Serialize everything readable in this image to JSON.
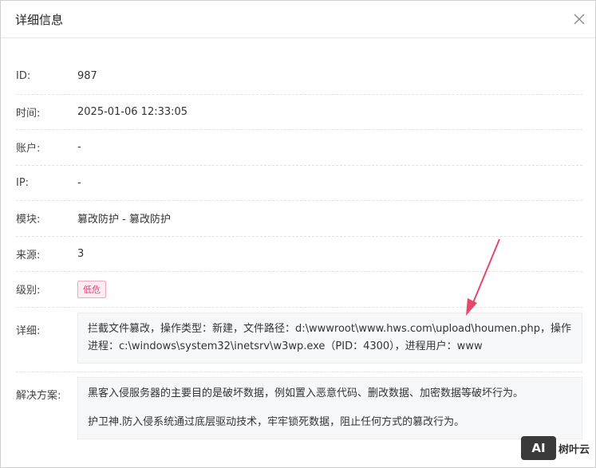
{
  "dialog": {
    "title": "详细信息"
  },
  "fields": {
    "id": {
      "label": "ID:",
      "value": "987"
    },
    "time": {
      "label": "时间:",
      "value": "2025-01-06 12:33:05"
    },
    "account": {
      "label": "账户:",
      "value": "-"
    },
    "ip": {
      "label": "IP:",
      "value": "-"
    },
    "module": {
      "label": "模块:",
      "value": "篡改防护 - 篡改防护"
    },
    "source": {
      "label": "来源:",
      "value": "3"
    },
    "level": {
      "label": "级别:",
      "value": "低危"
    },
    "detail": {
      "label": "详细:",
      "value": "拦截文件篡改，操作类型：新建，文件路径：d:\\wwwroot\\www.hws.com\\upload\\houmen.php，操作进程：c:\\windows\\system32\\inetsrv\\w3wp.exe（PID：4300），进程用户：www"
    },
    "solution": {
      "label": "解决方案:",
      "lines": [
        "黑客入侵服务器的主要目的是破坏数据，例如置入恶意代码、删改数据、加密数据等破坏行为。",
        "护卫神.防入侵系统通过底层驱动技术，牢牢锁死数据，阻止任何方式的篡改行为。"
      ]
    }
  },
  "watermark": {
    "logo": "AI",
    "text": "树叶云"
  },
  "colors": {
    "badge_text": "#e0457b",
    "badge_bg": "#fdeef4",
    "arrow": "#e5486a"
  },
  "icons": {
    "close": "close-icon",
    "arrow": "annotation-arrow"
  }
}
